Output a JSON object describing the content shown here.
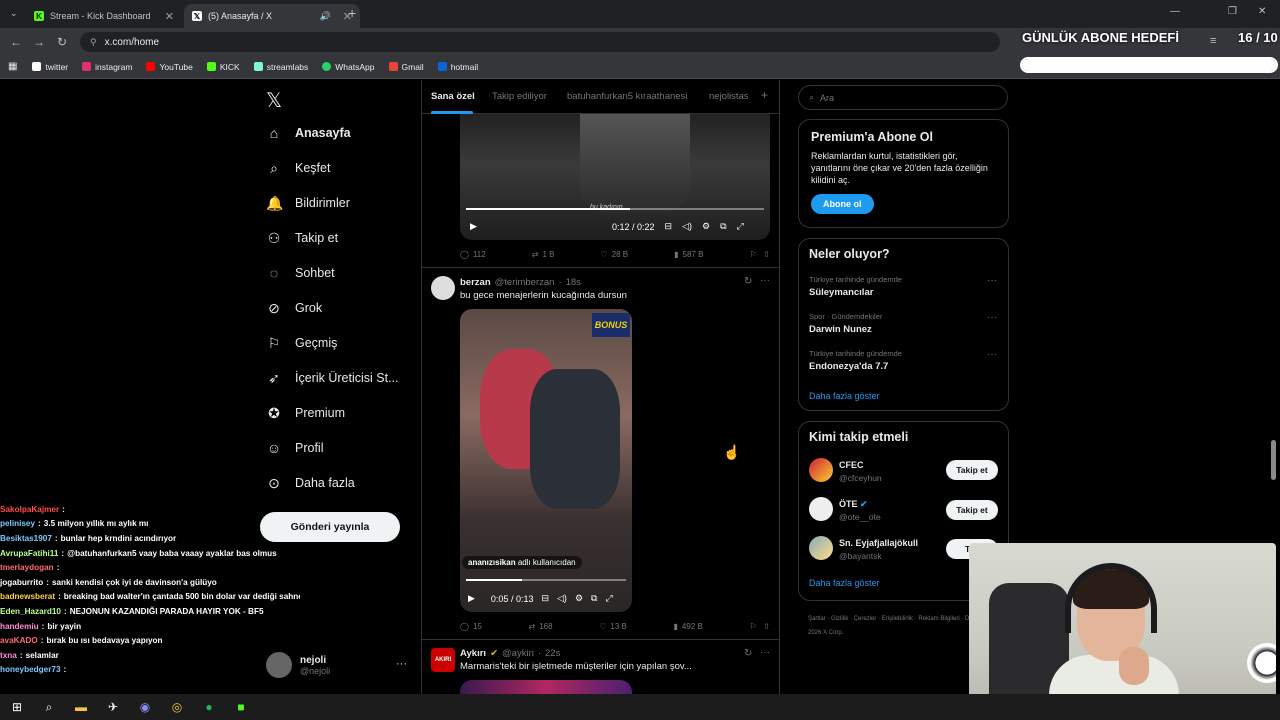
{
  "browser": {
    "tabs": [
      {
        "title": "Stream - Kick Dashboard"
      },
      {
        "title": "(5) Anasayfa / X"
      }
    ],
    "url": "x.com/home",
    "bookmarks": [
      "twitter",
      "instagram",
      "YouTube",
      "KICK",
      "streamlabs",
      "WhatsApp",
      "Gmail",
      "hotmail"
    ],
    "colors": {
      "kick": "#53fc18",
      "accent": "#1d9bf0"
    }
  },
  "overlay": {
    "title": "GÜNLÜK ABONE HEDEFİ",
    "count": "16 / 10",
    "progress_fraction": 1.0
  },
  "nav": {
    "items": [
      {
        "label": "Anasayfa",
        "icon": "home-icon"
      },
      {
        "label": "Keşfet",
        "icon": "search-icon"
      },
      {
        "label": "Bildirimler",
        "icon": "bell-icon"
      },
      {
        "label": "Takip et",
        "icon": "add-user-icon"
      },
      {
        "label": "Sohbet",
        "icon": "chat-icon"
      },
      {
        "label": "Grok",
        "icon": "grok-icon"
      },
      {
        "label": "Geçmiş",
        "icon": "bookmark-icon"
      },
      {
        "label": "İçerik Üreticisi St...",
        "icon": "rocket-icon"
      },
      {
        "label": "Premium",
        "icon": "verified-icon"
      },
      {
        "label": "Profil",
        "icon": "person-icon"
      },
      {
        "label": "Daha fazla",
        "icon": "more-circle-icon"
      }
    ],
    "post_button": "Gönderi yayınla",
    "profile": {
      "name": "nejoli",
      "handle": "@nejoli"
    }
  },
  "feed": {
    "tabs": [
      "Sana özel",
      "Takip ediliyor",
      "batuhanfurkan5 kıraathanesi",
      "nejolistas"
    ],
    "tweet1": {
      "video_time": "0:12 / 0:22",
      "video_caption": "bu kadının",
      "replies": "112",
      "reposts": "1 B",
      "likes": "28 B",
      "views": "587 B"
    },
    "tweet2": {
      "author": "berzan",
      "handle": "@terimberzan",
      "time": "18s",
      "text": "bu gece menajerlerin kucağında dursun",
      "sticker_user": "ananızısikan",
      "sticker_suffix": "adlı kullanıcıdan",
      "bonus": "BONUS",
      "video_time": "0:05 / 0:13",
      "replies": "15",
      "reposts": "168",
      "likes": "13 B",
      "views": "492 B"
    },
    "tweet3": {
      "author": "Aykırı",
      "handle": "@aykiri",
      "time": "22s",
      "text": "Marmaris'teki bir işletmede müşteriler için yapılan şov..."
    }
  },
  "sidebar": {
    "search_placeholder": "Ara",
    "premium": {
      "title": "Premium'a Abone Ol",
      "text": "Reklamlardan kurtul, istatistikleri gör, yanıtlarını öne çıkar ve 20'den fazla özelliğin kilidini aç.",
      "button": "Abone ol"
    },
    "trends": {
      "title": "Neler oluyor?",
      "items": [
        {
          "category": "Türkiye tarihinde gündemde",
          "name": "Süleymancılar"
        },
        {
          "category": "Spor · Gündemdekiler",
          "name": "Darwin Nunez"
        },
        {
          "category": "Türkiye tarihinde gündemde",
          "name": "Endonezya'da 7.7"
        }
      ],
      "more": "Daha fazla göster"
    },
    "who_to_follow": {
      "title": "Kimi takip etmeli",
      "items": [
        {
          "name": "CFEC",
          "handle": "@cfceyhun"
        },
        {
          "name": "ÖTE",
          "handle": "@ote__ote"
        },
        {
          "name": "Sn. Eyjafjallajökull",
          "handle": "@bayantsk"
        }
      ],
      "button": "Takip et",
      "button_partial": "Tak",
      "more": "Daha fazla göster"
    },
    "footer": "Şartlar · Gizlilik · Çerezler · Erişilebilirlik · Reklam Bilgileri · Daha fazla ··· © 2026 X Corp."
  },
  "chat": [
    {
      "user": "SakolpaKajmer",
      "msg": "",
      "color": "#ff4d4d"
    },
    {
      "user": "pelinisey",
      "msg": "3.5 milyon yıllık mı aylık mı",
      "color": "#7ec8ff"
    },
    {
      "user": "Besiktas1907",
      "msg": "bunlar hep krndini acındırıyor",
      "color": "#7ec8ff"
    },
    {
      "user": "AvrupaFatihi11",
      "msg": "@batuhanfurkan5 vaay baba vaaay ayaklar bas olmus",
      "color": "#b9ff8a"
    },
    {
      "user": "tmerlaydogan",
      "msg": "",
      "color": "#ff6b6b"
    },
    {
      "user": "jogaburrito",
      "msg": "sanki kendisi çok iyi de davinson'a gülüyo",
      "color": "#ffffff"
    },
    {
      "user": "badnewsberat",
      "msg": "breaking bad walter'ın çantada 500 bin dolar var dediği sahne",
      "color": "#ffd24d"
    },
    {
      "user": "Eden_Hazard10",
      "msg": "NEJONUN KAZANDIĞI PARADA HAYIR YOK - BF5",
      "color": "#b9ff8a"
    },
    {
      "user": "handemiu",
      "msg": "bir yayin",
      "color": "#ff8ad8"
    },
    {
      "user": "avaKADO",
      "msg": "bırak bu ısı bedavaya yapıyon",
      "color": "#ff6b6b"
    },
    {
      "user": "txna",
      "msg": "selamlar",
      "color": "#ff8ad8"
    },
    {
      "user": "honeybedger73",
      "msg": "",
      "color": "#7ec8ff"
    }
  ]
}
